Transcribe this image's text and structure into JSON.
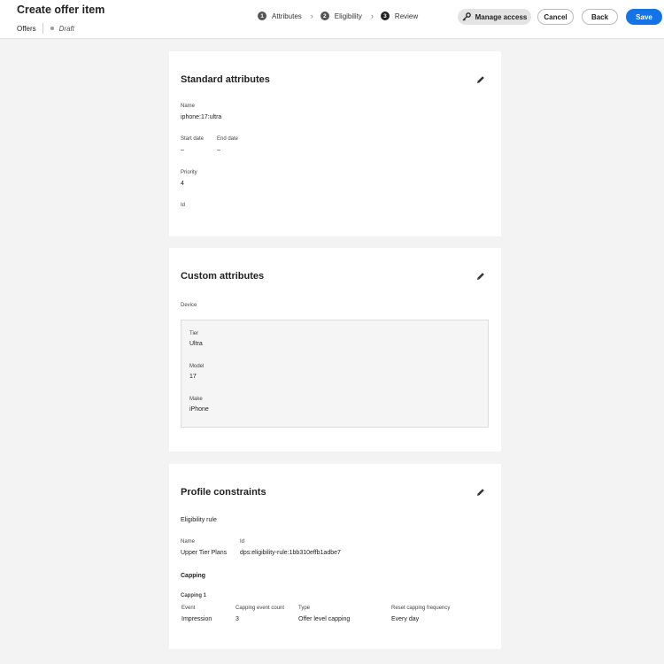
{
  "header": {
    "title": "Create offer item",
    "breadcrumb": "Offers",
    "status": "Draft",
    "steps": [
      {
        "num": "1",
        "label": "Attributes"
      },
      {
        "num": "2",
        "label": "Eligibility"
      },
      {
        "num": "3",
        "label": "Review"
      }
    ],
    "manage_label": "Manage access",
    "cancel_label": "Cancel",
    "back_label": "Back",
    "save_label": "Save",
    "colors": {
      "primary": "#1473e6"
    }
  },
  "standard": {
    "title": "Standard attributes",
    "name_label": "Name",
    "name_value": "iphone:17:ultra",
    "start_label": "Start date",
    "start_value": "–",
    "end_label": "End date",
    "end_value": "–",
    "priority_label": "Priority",
    "priority_value": "4",
    "id_label": "Id"
  },
  "custom": {
    "title": "Custom attributes",
    "device_label": "Device",
    "tier_label": "Tier",
    "tier_value": "Ultra",
    "model_label": "Model",
    "model_value": "17",
    "make_label": "Make",
    "make_value": "iPhone"
  },
  "profile": {
    "title": "Profile constraints",
    "rule_heading": "Eligibility rule",
    "name_label": "Name",
    "name_value": "Upper Tier Plans",
    "id_label": "Id",
    "id_value": "dps:eligibility-rule:1bb310effb1adbe7",
    "capping_heading": "Capping",
    "capping_sub": "Capping 1",
    "cols": [
      "Event",
      "Capping event count",
      "Type",
      "Reset capping frequency"
    ],
    "row": [
      "Impression",
      "3",
      "Offer level capping",
      "Every day"
    ]
  }
}
